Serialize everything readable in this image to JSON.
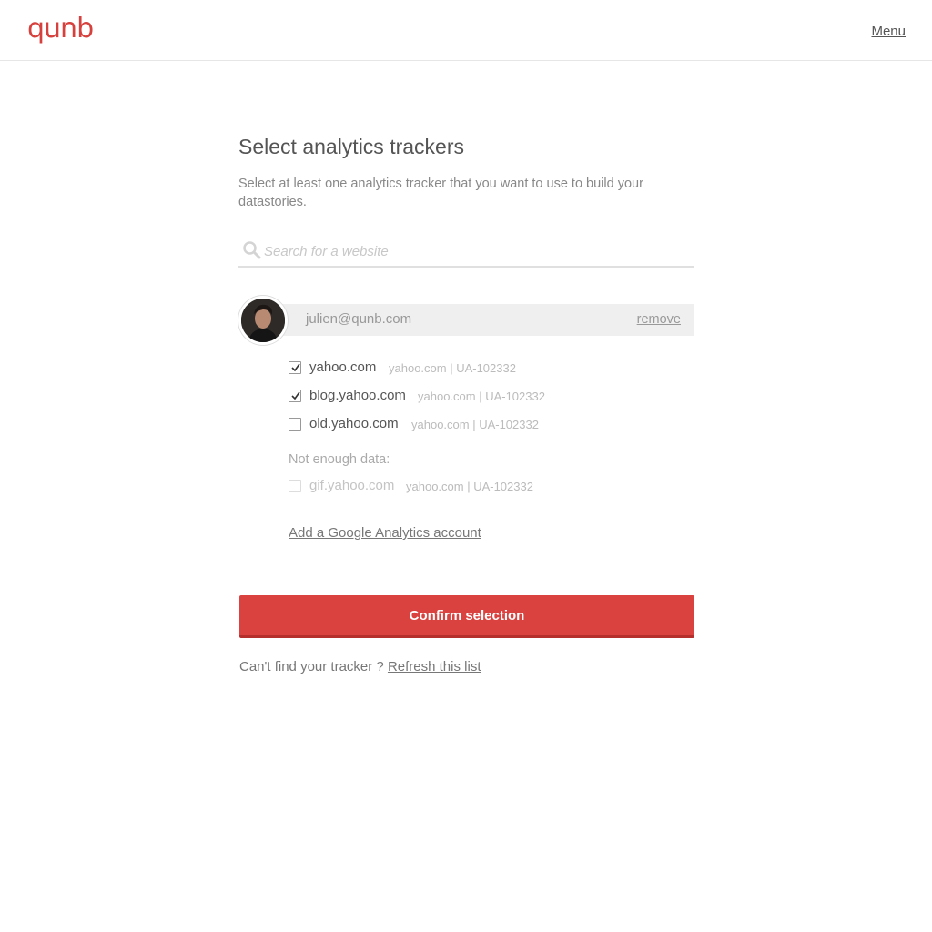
{
  "header": {
    "logo": "qunb",
    "menu_label": "Menu"
  },
  "page": {
    "title": "Select analytics trackers",
    "subtitle": "Select at least one analytics tracker that you want to use to build your datastories."
  },
  "search": {
    "placeholder": "Search for a website",
    "value": ""
  },
  "account": {
    "email": "julien@qunb.com",
    "remove_label": "remove"
  },
  "trackers": [
    {
      "name": "yahoo.com",
      "meta": "yahoo.com | UA-102332",
      "checked": true
    },
    {
      "name": "blog.yahoo.com",
      "meta": "yahoo.com | UA-102332",
      "checked": true
    },
    {
      "name": "old.yahoo.com",
      "meta": "yahoo.com | UA-102332",
      "checked": false
    }
  ],
  "insufficient": {
    "label": "Not enough data:",
    "trackers": [
      {
        "name": "gif.yahoo.com",
        "meta": "yahoo.com | UA-102332",
        "checked": false,
        "disabled": true
      }
    ]
  },
  "add_account_label": "Add a Google Analytics account",
  "confirm_label": "Confirm selection",
  "footer": {
    "prompt": "Can't find your tracker ?",
    "refresh_label": "Refresh this list"
  },
  "colors": {
    "brand": "#d6403d",
    "button": "#d9423f"
  }
}
